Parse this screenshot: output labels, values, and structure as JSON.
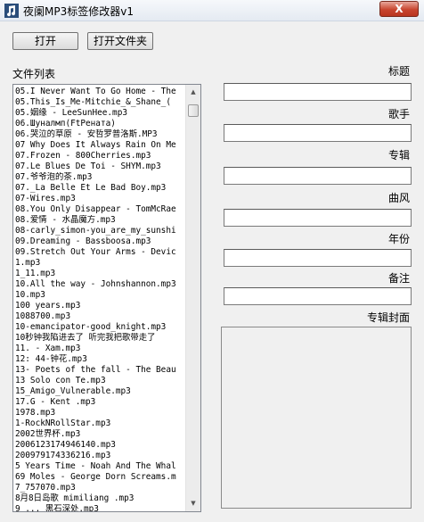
{
  "window": {
    "title": "夜阑MP3标签修改器v1",
    "close_label": "X"
  },
  "toolbar": {
    "open_label": "打开",
    "open_folder_label": "打开文件夹"
  },
  "file_list": {
    "label": "文件列表",
    "items": [
      "05.I Never Want To Go Home - The",
      "05.This_Is_Me-Mitchie_&_Shane_(",
      "05.姻缘 - LeeSunHee.mp3",
      "06.Шуналмп(FtPенатa)",
      "06.哭泣的草原 - 安哲罗普洛斯.MP3",
      "07 Why Does It Always Rain On Me",
      "07.Frozen - 800Cherries.mp3",
      "07.Le Blues De Toi - SHYM.mp3",
      "07.爷爷泡的茶.mp3",
      "07._La Belle Et Le Bad Boy.mp3",
      "07-Wires.mp3",
      "08.You Only Disappear - TomMcRae",
      "08.爱情 - 水晶魔方.mp3",
      "08-carly_simon-you_are_my_sunshi",
      "09.Dreaming - Bassboosa.mp3",
      "09.Stretch Out Your Arms - Devic",
      "1.mp3",
      "1_11.mp3",
      "10.All the way - Johnshannon.mp3",
      "10.mp3",
      "100 years.mp3",
      "1088700.mp3",
      "10-emancipator-good_knight.mp3",
      "10秒钟我陷进去了 听完我把歌带走了",
      "11. - Xam.mp3",
      "12: 44-钟花.mp3",
      "13- Poets of the fall - The Beau",
      "13 Solo con Te.mp3",
      "15_Amigo_Vulnerable.mp3",
      "17.G - Kent .mp3",
      "1978.mp3",
      "1-RockNRollStar.mp3",
      "2002世界杯.mp3",
      "2006123174946140.mp3",
      "200979174336216.mp3",
      "5 Years Time - Noah And The Whal",
      "69 Moles - George Dorn Screams.m",
      "7_757070.mp3",
      "8月8日岛歌 mimiliang      .mp3",
      "9 ... 黑石深处.mp3"
    ]
  },
  "fields": {
    "title_label": "标题",
    "title_value": "",
    "artist_label": "歌手",
    "artist_value": "",
    "album_label": "专辑",
    "album_value": "",
    "genre_label": "曲风",
    "genre_value": "",
    "year_label": "年份",
    "year_value": "",
    "comment_label": "备注",
    "comment_value": "",
    "cover_label": "专辑封面"
  },
  "icons": {
    "app": "music-note-icon",
    "scroll_up": "scroll-up-arrow-icon",
    "scroll_down": "scroll-down-arrow-icon"
  },
  "colors": {
    "close_button": "#c8452f",
    "background": "#f0f0f0"
  }
}
